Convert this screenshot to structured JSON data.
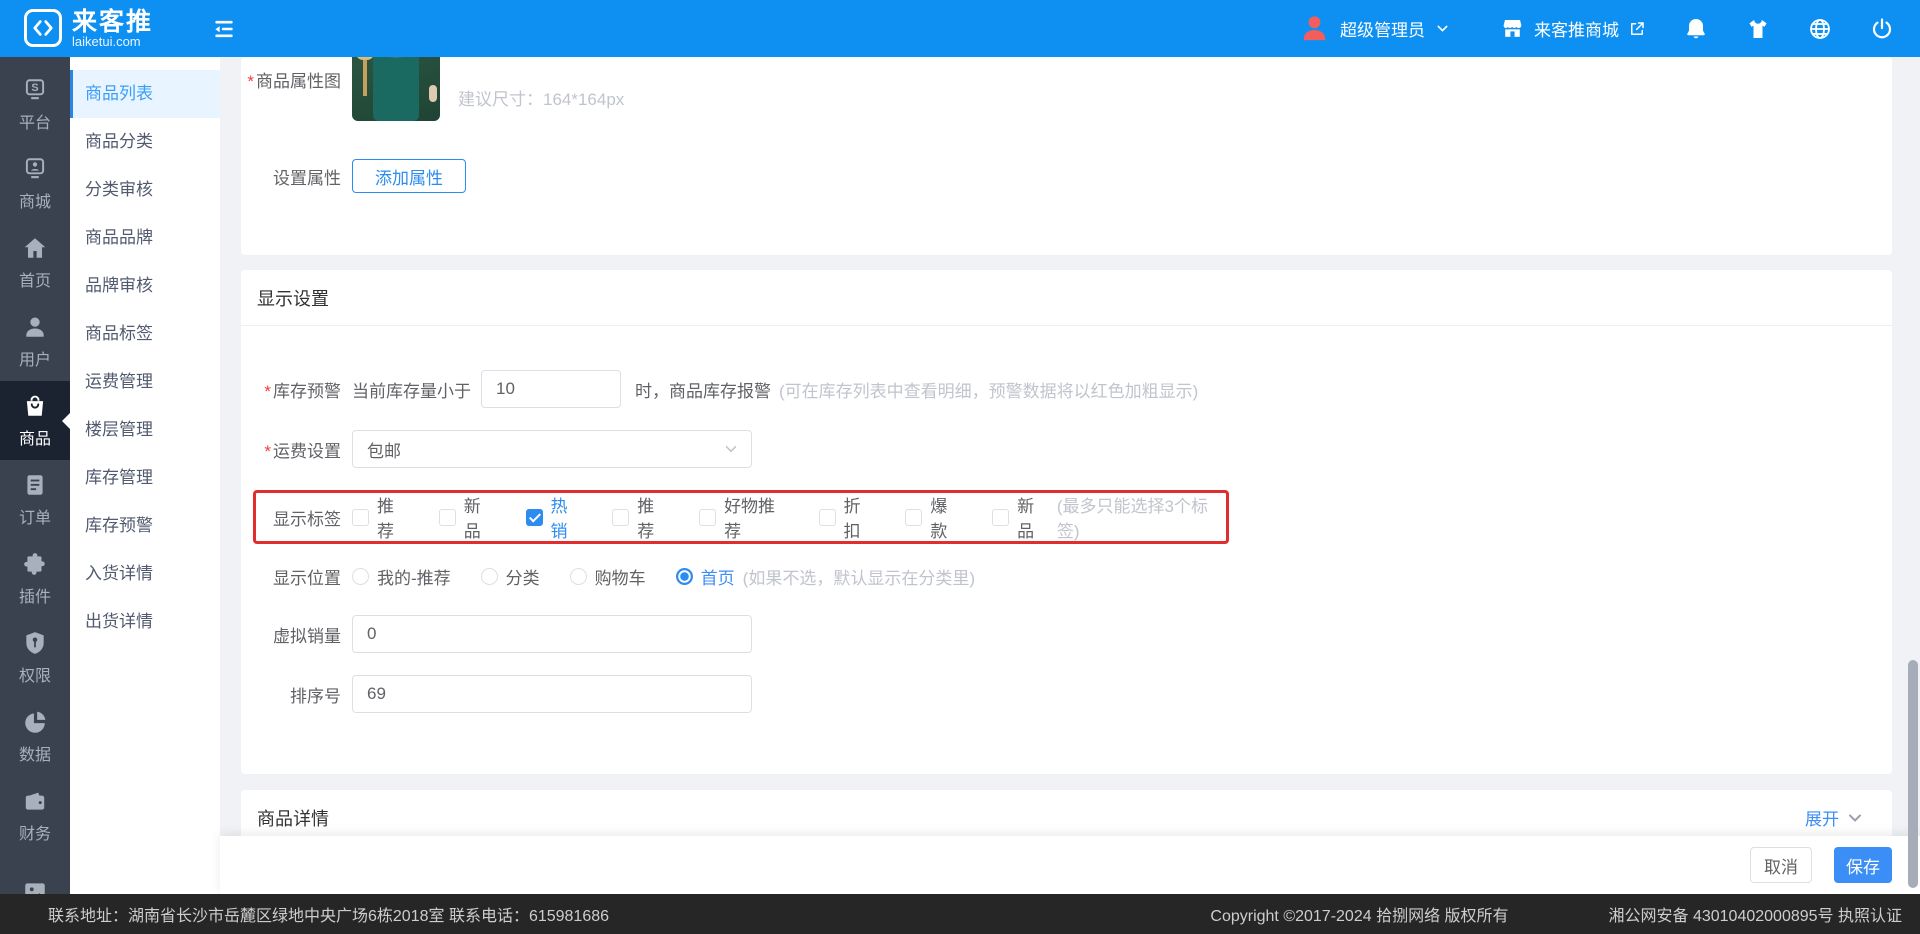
{
  "navbar": {
    "logo_title": "来客推",
    "logo_domain": "laiketui.com",
    "user_name": "超级管理员",
    "store_link": "来客推商城"
  },
  "sidebar": {
    "items": [
      {
        "label": "平台"
      },
      {
        "label": "商城"
      },
      {
        "label": "首页"
      },
      {
        "label": "用户"
      },
      {
        "label": "商品"
      },
      {
        "label": "订单"
      },
      {
        "label": "插件"
      },
      {
        "label": "权限"
      },
      {
        "label": "数据"
      },
      {
        "label": "财务"
      },
      {
        "label": ""
      }
    ]
  },
  "submenu": {
    "items": [
      "商品列表",
      "商品分类",
      "分类审核",
      "商品品牌",
      "品牌审核",
      "商品标签",
      "运费管理",
      "楼层管理",
      "库存管理",
      "库存预警",
      "入货详情",
      "出货详情"
    ]
  },
  "attr_card": {
    "image_label": "商品属性图",
    "image_hint": "建议尺寸：164*164px",
    "set_label": "设置属性",
    "add_button": "添加属性"
  },
  "display": {
    "title": "显示设置",
    "stock": {
      "label": "库存预警",
      "prefix": "当前库存量小于",
      "value": "10",
      "suffix": "时，商品库存报警",
      "hint": "(可在库存列表中查看明细，预警数据将以红色加粗显示)"
    },
    "freight": {
      "label": "运费设置",
      "value": "包邮"
    },
    "tags": {
      "label": "显示标签",
      "hint": "(最多只能选择3个标签)",
      "options": [
        {
          "label": "推荐",
          "checked": false
        },
        {
          "label": "新品",
          "checked": false
        },
        {
          "label": "热销",
          "checked": true
        },
        {
          "label": "推荐",
          "checked": false
        },
        {
          "label": "好物推荐",
          "checked": false
        },
        {
          "label": "折扣",
          "checked": false
        },
        {
          "label": "爆款",
          "checked": false
        },
        {
          "label": "新品",
          "checked": false
        }
      ]
    },
    "position": {
      "label": "显示位置",
      "hint": "(如果不选，默认显示在分类里)",
      "options": [
        {
          "label": "我的-推荐",
          "checked": false
        },
        {
          "label": "分类",
          "checked": false
        },
        {
          "label": "购物车",
          "checked": false
        },
        {
          "label": "首页",
          "checked": true
        }
      ]
    },
    "virtual_sales": {
      "label": "虚拟销量",
      "value": "0"
    },
    "sort": {
      "label": "排序号",
      "value": "69"
    }
  },
  "detail": {
    "title": "商品详情",
    "expand": "展开"
  },
  "actions": {
    "cancel": "取消",
    "save": "保存"
  },
  "footer": {
    "address": "联系地址：湖南省长沙市岳麓区绿地中央广场6栋2018室 联系电话：615981686",
    "copyright": "Copyright ©2017-2024 拾捌网络 版权所有",
    "record": "湘公网安备 43010402000895号 执照认证"
  },
  "misc": {
    "required_mark": "*"
  },
  "colors": {
    "navbar": "#0e90f2",
    "primary": "#2d8cf0",
    "highlight_border": "#e12d2d",
    "save_button": "#3a8ef6",
    "footer_bg": "#262626"
  }
}
